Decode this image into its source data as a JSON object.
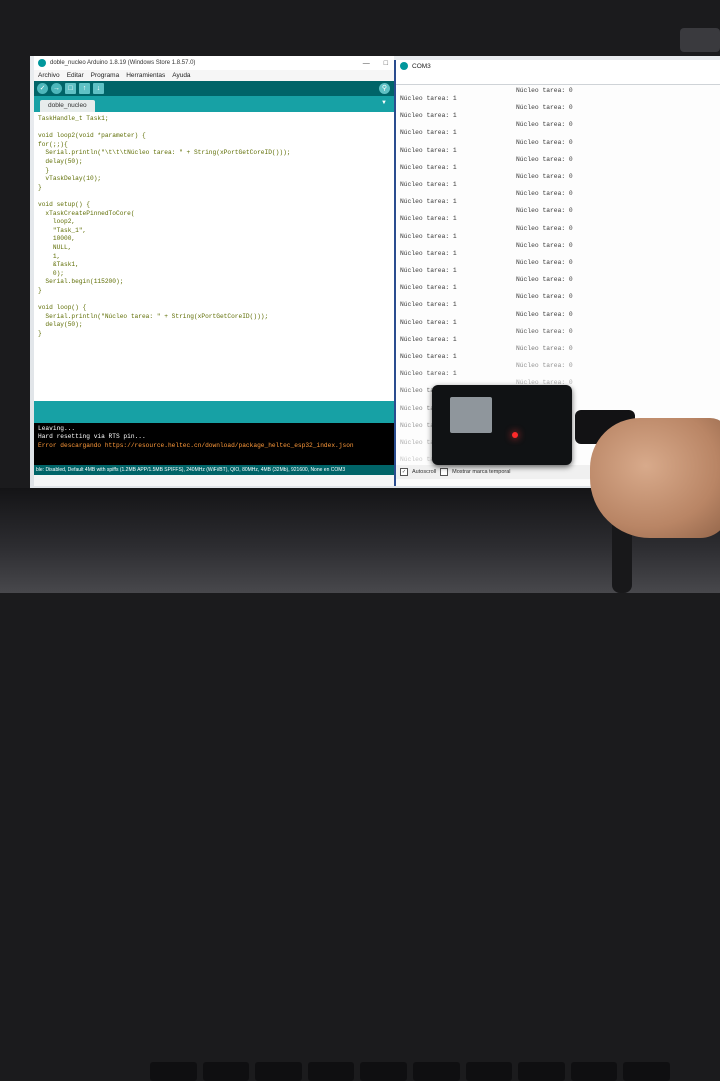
{
  "ide": {
    "title": "doble_nucleo Arduino 1.8.19 (Windows Store 1.8.57.0)",
    "menu": [
      "Archivo",
      "Editar",
      "Programa",
      "Herramientas",
      "Ayuda"
    ],
    "tab_label": "doble_nucleo",
    "code": [
      "TaskHandle_t Task1;",
      "",
      "void loop2(void *parameter) {",
      "for(;;){",
      "  Serial.println(\"\\t\\t\\tNúcleo tarea: \" + String(xPortGetCoreID()));",
      "  delay(50);",
      "  }",
      "  vTaskDelay(10);",
      "}",
      "",
      "void setup() {",
      "  xTaskCreatePinnedToCore(",
      "    loop2,",
      "    \"Task_1\",",
      "    10000,",
      "    NULL,",
      "    1,",
      "    &Task1,",
      "    0);",
      "  Serial.begin(115200);",
      "}",
      "",
      "void loop() {",
      "  Serial.println(\"Núcleo tarea: \" + String(xPortGetCoreID()));",
      "  delay(50);",
      "}"
    ],
    "console": [
      {
        "text": "Leaving...",
        "color": "#ffffff"
      },
      {
        "text": "Hard resetting via RTS pin...",
        "color": "#ffffff"
      },
      {
        "text": "Error descargando https://resource.heltec.cn/download/package_heltec_esp32_index.json",
        "color": "#ff9a3a"
      }
    ],
    "status": "ble: Disabled, Default 4MB with spiffs (1.2MB APP/1.5MB SPIFFS), 240MHz (WiFi/BT), QIO, 80MHz, 4MB (32Mb), 921600, None en COM3"
  },
  "serial": {
    "title": "COM3",
    "left_label": "Núcleo tarea: 1",
    "right_label": "Núcleo tarea: 0",
    "autoscroll_label": "Autoscroll",
    "timestamp_label": "Mostrar marca temporal",
    "bottom_right": "Nu"
  },
  "colors": {
    "teal_dark": "#006468",
    "teal": "#17a1a5",
    "error_text": "#ff9a3a"
  }
}
